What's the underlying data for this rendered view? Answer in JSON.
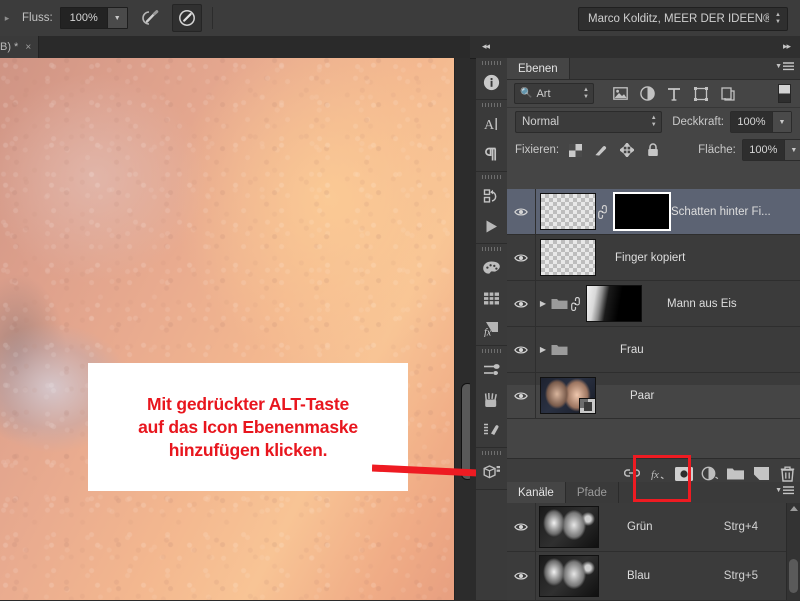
{
  "app": {
    "options_bar": {
      "flow_label": "Fluss:",
      "flow_value": "100%",
      "airbrush_icon": "airbrush-icon",
      "tablet_pressure_icon": "tablet-pressure-icon",
      "preset_name": "Marco Kolditz, MEER DER IDEEN®"
    },
    "document_tab": {
      "title": "B) *",
      "close": "×",
      "dirty": true
    },
    "panel_collapse": {
      "left": "◂◂",
      "right": "▸▸"
    }
  },
  "icon_dock": {
    "items": [
      {
        "name": "info-icon",
        "group": 0
      },
      {
        "name": "character-icon",
        "group": 1
      },
      {
        "name": "paragraph-icon",
        "group": 1
      },
      {
        "name": "history-icon",
        "group": 2
      },
      {
        "name": "actions-play-icon",
        "group": 2
      },
      {
        "name": "swatches-palette-icon",
        "group": 3
      },
      {
        "name": "color-grid-icon",
        "group": 3
      },
      {
        "name": "styles-fx-icon",
        "group": 3
      },
      {
        "name": "brush-presets-icon",
        "group": 4
      },
      {
        "name": "brushes-icon",
        "group": 4
      },
      {
        "name": "tool-presets-icon",
        "group": 4
      },
      {
        "name": "three-d-icon",
        "group": 5
      }
    ]
  },
  "layers_panel": {
    "tab_label": "Ebenen",
    "menu_icon": "panel-menu-icon",
    "filter": {
      "kind_label": "Art",
      "search_icon": "search-icon",
      "icons": [
        "image-filter-icon",
        "adjustment-filter-icon",
        "type-filter-icon",
        "shape-filter-icon",
        "smartobject-filter-icon"
      ],
      "toggle_icon": "filter-toggle-icon"
    },
    "blend_mode": "Normal",
    "opacity_label": "Deckkraft:",
    "opacity_value": "100%",
    "lock_label": "Fixieren:",
    "lock_icons": [
      "lock-transparency-icon",
      "lock-image-icon",
      "lock-position-icon",
      "lock-all-icon"
    ],
    "fill_label": "Fläche:",
    "fill_value": "100%",
    "layers": [
      {
        "name": "Schatten hinter Fi...",
        "visible": true,
        "selected": true,
        "type": "layer",
        "thumb": "transparent",
        "has_mask": true,
        "mask_thumb": "black",
        "mask_selected": true,
        "linked": true
      },
      {
        "name": "Finger kopiert",
        "visible": true,
        "selected": false,
        "type": "layer",
        "thumb": "transparent",
        "has_mask": false
      },
      {
        "name": "Mann aus Eis",
        "visible": true,
        "selected": false,
        "type": "group",
        "expanded": false,
        "has_mask": true,
        "mask_thumb": "figure",
        "linked": true
      },
      {
        "name": "Frau",
        "visible": true,
        "selected": false,
        "type": "group",
        "expanded": false,
        "has_mask": false
      },
      {
        "name": "Paar",
        "visible": true,
        "selected": false,
        "type": "smartobject",
        "thumb": "photo",
        "has_mask": false
      }
    ],
    "bottom_buttons": [
      {
        "name": "link-layers-button",
        "icon": "link-icon"
      },
      {
        "name": "layer-style-button",
        "icon": "fx-icon"
      },
      {
        "name": "add-layer-mask-button",
        "icon": "add-layer-mask-icon",
        "highlighted": true
      },
      {
        "name": "new-adjustment-layer-button",
        "icon": "adjustment-circle-icon"
      },
      {
        "name": "new-group-button",
        "icon": "folder-icon"
      },
      {
        "name": "new-layer-button",
        "icon": "new-layer-icon"
      },
      {
        "name": "delete-layer-button",
        "icon": "trash-icon"
      }
    ]
  },
  "channels_panel": {
    "tabs": [
      {
        "label": "Kanäle",
        "active": true
      },
      {
        "label": "Pfade",
        "active": false
      }
    ],
    "menu_icon": "panel-menu-icon",
    "channels": [
      {
        "name": "Grün",
        "shortcut": "Strg+4",
        "visible": true
      },
      {
        "name": "Blau",
        "shortcut": "Strg+5",
        "visible": true
      }
    ]
  },
  "annotation": {
    "lines": [
      "Mit gedrückter ALT-Taste",
      "auf das Icon Ebenenmaske",
      "hinzufügen klicken."
    ],
    "color": "#e8161e",
    "arrow_to_mask_button": true,
    "arrow_from_mask_button_to_layer_mask": true
  }
}
